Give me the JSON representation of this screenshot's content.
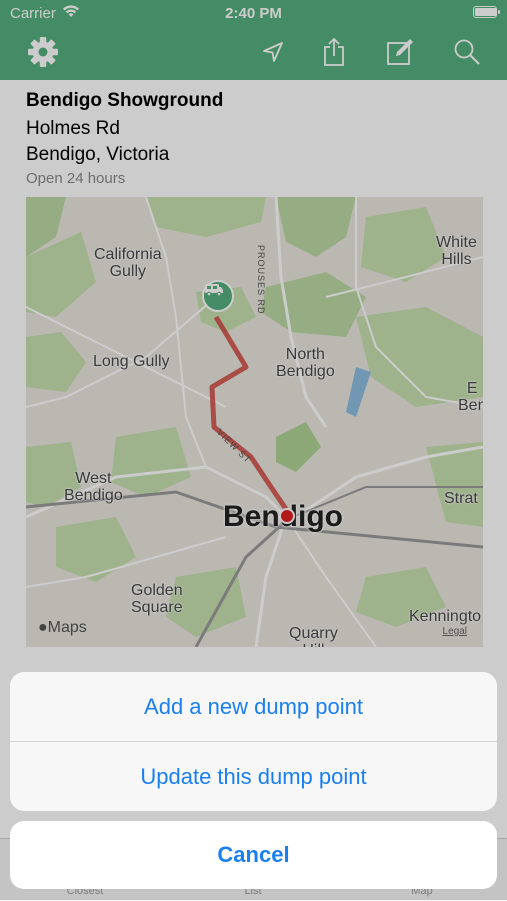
{
  "status_bar": {
    "carrier": "Carrier",
    "time": "2:40 PM",
    "battery_level": 1.0
  },
  "nav": {
    "icons": [
      "gear-icon",
      "location-arrow-icon",
      "share-icon",
      "edit-icon",
      "search-icon"
    ]
  },
  "location": {
    "name": "Bendigo Showground",
    "address_line1": "Holmes Rd",
    "address_line2": "Bendigo, Victoria",
    "hours": "Open 24 hours"
  },
  "map": {
    "labels": {
      "california_gully": "California\nGully",
      "white_hills": "White\nHills",
      "long_gully": "Long Gully",
      "north_bendigo": "North\nBendigo",
      "west_bendigo": "West\nBendigo",
      "golden_square": "Golden\nSquare",
      "quarry_hill": "Quarry\nHill",
      "kennington": "Kenningto",
      "strat": "Strat",
      "e_ben": "E\nBen",
      "city": "Bendigo",
      "road_prouses": "PROUSES RD",
      "road_view": "VIEW ST"
    },
    "attribution": "Maps",
    "legal": "Legal"
  },
  "action_sheet": {
    "actions": [
      {
        "label": "Add a new dump point"
      },
      {
        "label": "Update this dump point"
      }
    ],
    "cancel": "Cancel"
  },
  "tab_bar": {
    "tabs": [
      "Closest",
      "List",
      "Map"
    ]
  },
  "colors": {
    "brand_green": "#55b07f",
    "action_blue": "#1a7ff0",
    "route_red": "#d0463f"
  }
}
